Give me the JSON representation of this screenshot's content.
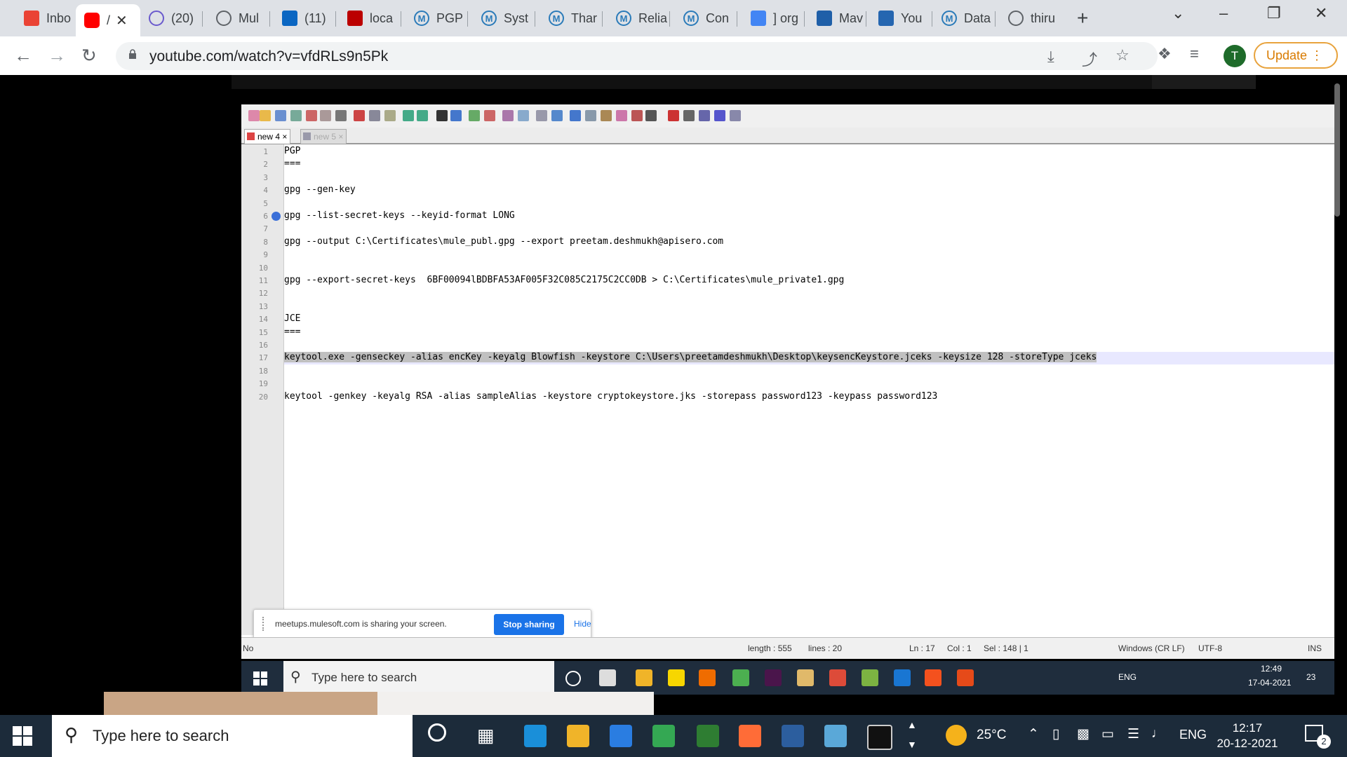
{
  "browser": {
    "tabs": [
      {
        "label": "Inbo",
        "icon": "gmail-icon",
        "color": "#ea4335"
      },
      {
        "label": "/",
        "icon": "youtube-icon",
        "color": "#ff0000",
        "active": true
      },
      {
        "label": "(20)",
        "icon": "app-icon",
        "color": "#6a5acd"
      },
      {
        "label": "Mul",
        "icon": "globe-icon",
        "color": "#5f6368"
      },
      {
        "label": "(11)",
        "icon": "linkedin-icon",
        "color": "#0a66c2"
      },
      {
        "label": "loca",
        "icon": "amq-icon",
        "color": "#b00"
      },
      {
        "label": "PGP",
        "icon": "m-icon",
        "color": "#2b7bb9"
      },
      {
        "label": "Syst",
        "icon": "m-icon",
        "color": "#2b7bb9"
      },
      {
        "label": "Thar",
        "icon": "m-icon",
        "color": "#2b7bb9"
      },
      {
        "label": "Relia",
        "icon": "m-icon",
        "color": "#2b7bb9"
      },
      {
        "label": "Con",
        "icon": "m-icon",
        "color": "#2b7bb9"
      },
      {
        "label": "] org",
        "icon": "google-icon",
        "color": "#4285f4"
      },
      {
        "label": "Mav",
        "icon": "mvn-icon",
        "color": "#1f5fa8"
      },
      {
        "label": "You",
        "icon": "mulesoft-icon",
        "color": "#2566b0"
      },
      {
        "label": "Data",
        "icon": "m-icon",
        "color": "#2b7bb9"
      },
      {
        "label": "thiru",
        "icon": "globe-icon",
        "color": "#5f6368"
      }
    ],
    "url": "youtube.com/watch?v=vfdRLs9n5Pk",
    "profile_initial": "T",
    "update_label": "Update"
  },
  "npp": {
    "tabs": [
      "new 4",
      "new 5"
    ],
    "lines": [
      {
        "n": "1",
        "text": "PGP"
      },
      {
        "n": "2",
        "text": "==="
      },
      {
        "n": "3",
        "text": ""
      },
      {
        "n": "4",
        "text": "gpg --gen-key"
      },
      {
        "n": "5",
        "text": ""
      },
      {
        "n": "6",
        "text": "gpg --list-secret-keys --keyid-format LONG"
      },
      {
        "n": "7",
        "text": ""
      },
      {
        "n": "8",
        "text": "gpg --output C:\\Certificates\\mule_publ.gpg --export preetam.deshmukh@apisero.com"
      },
      {
        "n": "9",
        "text": ""
      },
      {
        "n": "10",
        "text": ""
      },
      {
        "n": "11",
        "text": "gpg --export-secret-keys  6BF00094lBDBFA53AF005F32C085C2175C2CC0DB > C:\\Certificates\\mule_private1.gpg"
      },
      {
        "n": "12",
        "text": ""
      },
      {
        "n": "13",
        "text": ""
      },
      {
        "n": "14",
        "text": "JCE"
      },
      {
        "n": "15",
        "text": "==="
      },
      {
        "n": "16",
        "text": ""
      },
      {
        "n": "17",
        "text": "keytool.exe -genseckey -alias encKey -keyalg Blowfish -keystore C:\\Users\\preetamdeshmukh\\Desktop\\keysencKeystore.jceks -keysize 128 -storeType jceks"
      },
      {
        "n": "18",
        "text": ""
      },
      {
        "n": "19",
        "text": ""
      },
      {
        "n": "20",
        "text": "keytool -genkey -keyalg RSA -alias sampleAlias -keystore cryptokeystore.jks -storepass password123 -keypass password123"
      }
    ],
    "status": {
      "left": "No",
      "length": "length : 555",
      "lines": "lines : 20",
      "ln": "Ln : 17",
      "col": "Col : 1",
      "sel": "Sel : 148 | 1",
      "eol": "Windows (CR LF)",
      "enc": "UTF-8",
      "ins": "INS"
    },
    "share": {
      "message": "meetups.mulesoft.com is sharing your screen.",
      "stop": "Stop sharing",
      "hide": "Hide"
    }
  },
  "inner_taskbar": {
    "search": "Type here to search",
    "lang": "ENG",
    "time": "12:49",
    "date": "17-04-2021",
    "notif": "23"
  },
  "taskbar": {
    "search": "Type here to search",
    "weather": "25°C",
    "lang": "ENG",
    "time": "12:17",
    "date": "20-12-2021",
    "notif": "2"
  }
}
